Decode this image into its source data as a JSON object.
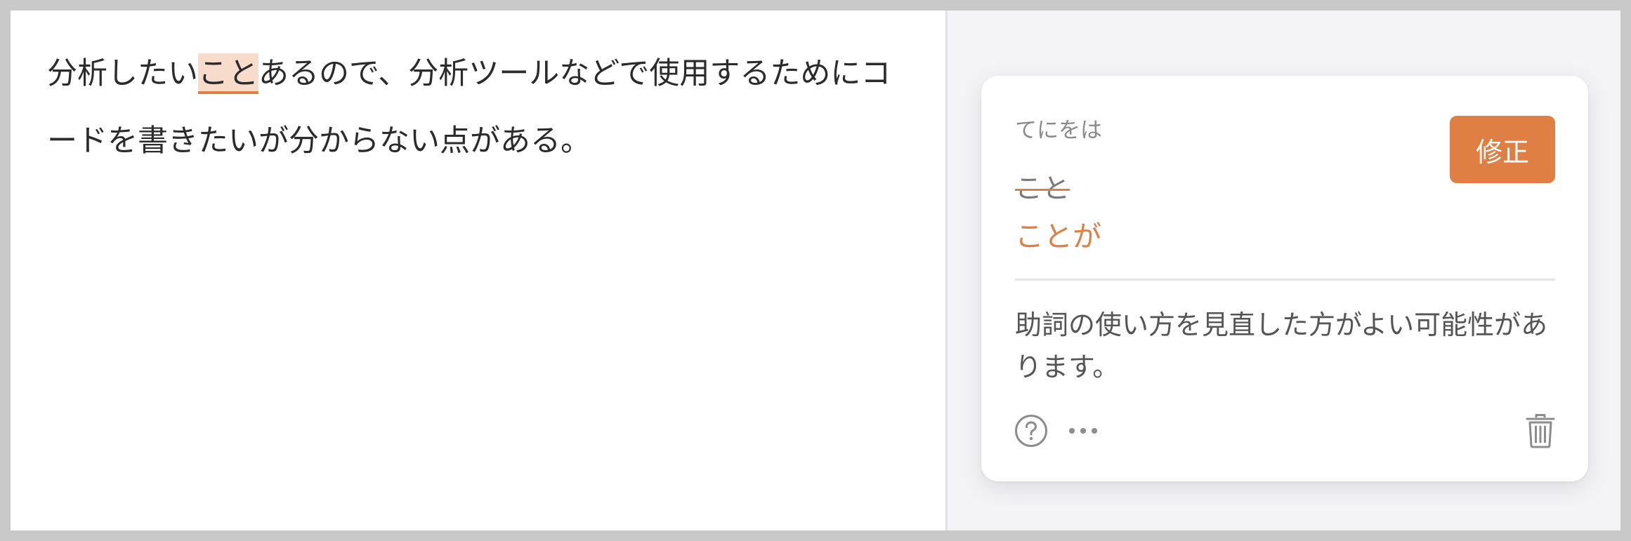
{
  "editor": {
    "text_before": "分析したい",
    "highlighted": "こと",
    "text_after": "あるので、分析ツールなどで使用するためにコードを書きたいが分からない点がある。"
  },
  "suggestion": {
    "category": "てにをは",
    "fix_button_label": "修正",
    "original_text": "こと",
    "replacement_text": "ことが",
    "message": "助詞の使い方を見直した方がよい可能性があります。",
    "icons": {
      "help": "help-circle-icon",
      "more": "more-horizontal-icon",
      "delete": "trash-icon"
    }
  },
  "colors": {
    "accent": "#e07f44",
    "highlight_bg": "#f7dccb",
    "side_bg": "#f4f4f7",
    "frame": "#c9c9c9"
  }
}
